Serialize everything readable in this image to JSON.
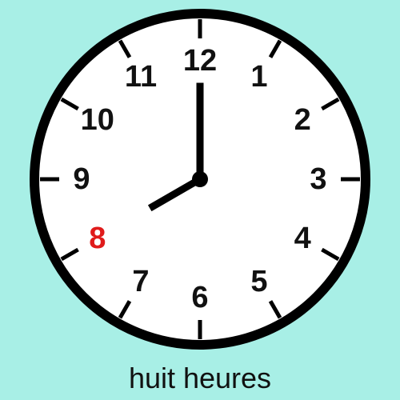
{
  "colors": {
    "background": "#a8efe6",
    "face": "#ffffff",
    "rim": "#000000",
    "numeral": "#111111",
    "highlight": "#e01b1b"
  },
  "clock": {
    "numerals": [
      "12",
      "1",
      "2",
      "3",
      "4",
      "5",
      "6",
      "7",
      "8",
      "9",
      "10",
      "11"
    ],
    "highlighted_numeral": "8",
    "time": {
      "hour": 8,
      "minute": 0
    }
  },
  "caption": "huit heures"
}
